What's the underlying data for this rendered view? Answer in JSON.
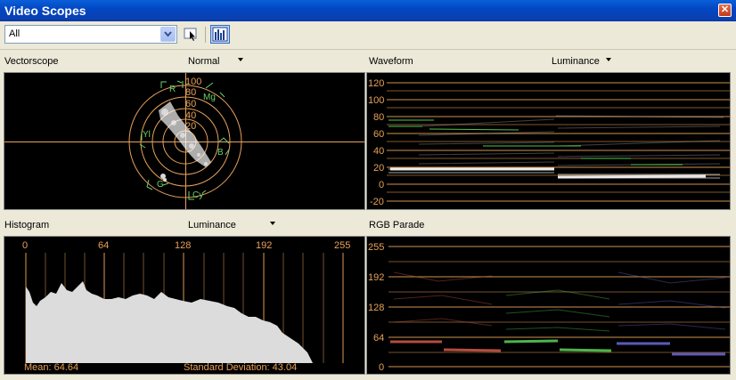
{
  "window": {
    "title": "Video Scopes"
  },
  "toolbar": {
    "source_value": "All"
  },
  "vectorscope": {
    "label": "Vectorscope",
    "mode": "Normal",
    "ring_labels": [
      "100",
      "80",
      "60",
      "40",
      "20"
    ],
    "target_labels": [
      "R",
      "Mg",
      "Yl",
      "B",
      "G",
      "Cy"
    ]
  },
  "waveform": {
    "label": "Waveform",
    "mode": "Luminance",
    "y_ticks": [
      "120",
      "100",
      "80",
      "60",
      "40",
      "20",
      "0",
      "-20"
    ]
  },
  "histogram": {
    "label": "Histogram",
    "mode": "Luminance",
    "x_ticks": [
      "0",
      "64",
      "128",
      "192",
      "255"
    ],
    "mean_label": "Mean: 64.64",
    "std_label": "Standard Deviation: 43.04"
  },
  "rgb_parade": {
    "label": "RGB Parade",
    "y_ticks": [
      "255",
      "192",
      "128",
      "64",
      "0"
    ]
  },
  "colors": {
    "scope_bg": "#000000",
    "graticule": "#e8a25a",
    "target": "#6ccf6c",
    "trace": "#d8d8d8",
    "red": "#d35a4a",
    "green": "#5ad35a",
    "blue": "#6a6ad8"
  }
}
